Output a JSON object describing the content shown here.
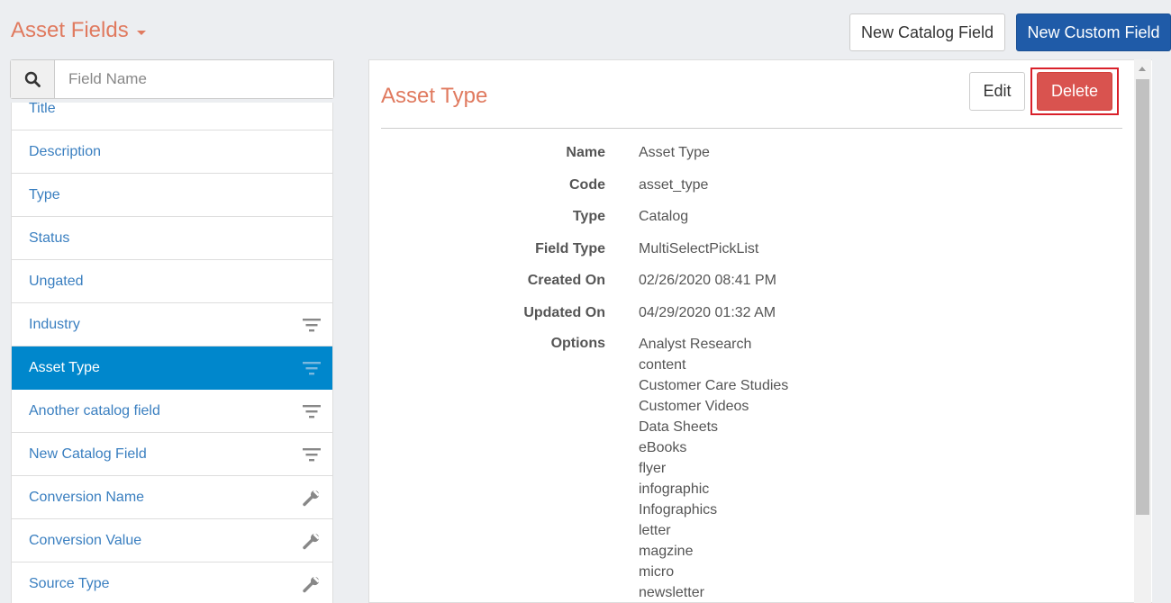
{
  "header": {
    "title": "Asset Fields",
    "new_catalog_label": "New Catalog Field",
    "new_custom_label": "New Custom Field"
  },
  "search": {
    "placeholder": "Field Name"
  },
  "field_list": [
    {
      "label": "Title",
      "icon": ""
    },
    {
      "label": "Description",
      "icon": ""
    },
    {
      "label": "Type",
      "icon": ""
    },
    {
      "label": "Status",
      "icon": ""
    },
    {
      "label": "Ungated",
      "icon": ""
    },
    {
      "label": "Industry",
      "icon": "filter-icon"
    },
    {
      "label": "Asset Type",
      "icon": "filter-icon",
      "active": true
    },
    {
      "label": "Another catalog field",
      "icon": "filter-icon"
    },
    {
      "label": "New Catalog Field",
      "icon": "filter-icon"
    },
    {
      "label": "Conversion Name",
      "icon": "wrench-icon"
    },
    {
      "label": "Conversion Value",
      "icon": "wrench-icon"
    },
    {
      "label": "Source Type",
      "icon": "wrench-icon"
    }
  ],
  "detail": {
    "title": "Asset Type",
    "edit_label": "Edit",
    "delete_label": "Delete",
    "rows": [
      {
        "label": "Name",
        "value": "Asset Type"
      },
      {
        "label": "Code",
        "value": "asset_type"
      },
      {
        "label": "Type",
        "value": "Catalog"
      },
      {
        "label": "Field Type",
        "value": "MultiSelectPickList"
      },
      {
        "label": "Created On",
        "value": "02/26/2020 08:41 PM"
      },
      {
        "label": "Updated On",
        "value": "04/29/2020 01:32 AM"
      }
    ],
    "options_label": "Options",
    "options": [
      "Analyst Research",
      "content",
      "Customer Care Studies",
      "Customer Videos",
      "Data Sheets",
      "eBooks",
      "flyer",
      "infographic",
      "Infographics",
      "letter",
      "magzine",
      "micro",
      "newsletter"
    ]
  },
  "colors": {
    "accent_title": "#e07a5f",
    "primary_button": "#1f5ba8",
    "active_item": "#0087cc",
    "delete_button": "#d9534f",
    "link_text": "#3a7fc0"
  }
}
